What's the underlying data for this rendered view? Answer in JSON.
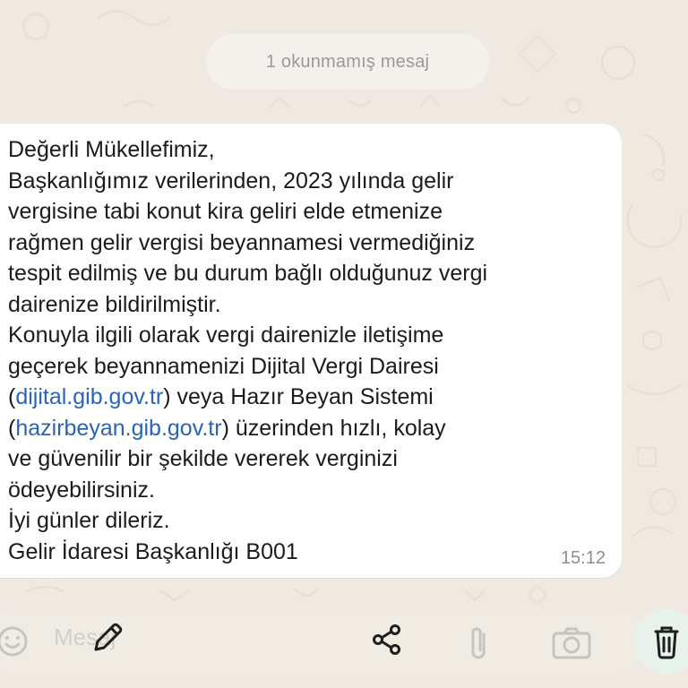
{
  "chat": {
    "unread_banner": "1 okunmamış mesaj"
  },
  "message": {
    "lines": [
      {
        "text": "Değerli Mükellefimiz,"
      },
      {
        "text": "Başkanlığımız verilerinden, 2023 yılında gelir"
      },
      {
        "text": "vergisine tabi konut kira geliri elde etmenize"
      },
      {
        "text": "rağmen gelir vergisi beyannamesi vermediğiniz"
      },
      {
        "text": "tespit edilmiş ve bu durum bağlı olduğunuz vergi"
      },
      {
        "text": "dairenize bildirilmiştir."
      },
      {
        "text": "Konuyla ilgili olarak vergi dairenizle iletişime"
      },
      {
        "text": "geçerek beyannamenizi Dijital Vergi Dairesi"
      },
      {
        "before": "(",
        "link": "dijital.gib.gov.tr",
        "after": ") veya Hazır Beyan Sistemi"
      },
      {
        "before": "(",
        "link": "hazirbeyan.gib.gov.tr",
        "after": ") üzerinden hızlı, kolay"
      },
      {
        "text": "ve güvenilir bir şekilde vererek verginizi"
      },
      {
        "text": "ödeyebilirsiniz."
      },
      {
        "text": "İyi günler dileriz."
      },
      {
        "text": "Gelir İdaresi Başkanlığı B001"
      }
    ],
    "time": "15:12",
    "link_color": "#2a64b5"
  },
  "input_bar": {
    "placeholder": "Mesaj",
    "icons": [
      "emoji-icon",
      "edit-icon",
      "share-icon",
      "attach-icon",
      "camera-icon",
      "delete-icon"
    ],
    "accent_color": "#1f7a55"
  }
}
